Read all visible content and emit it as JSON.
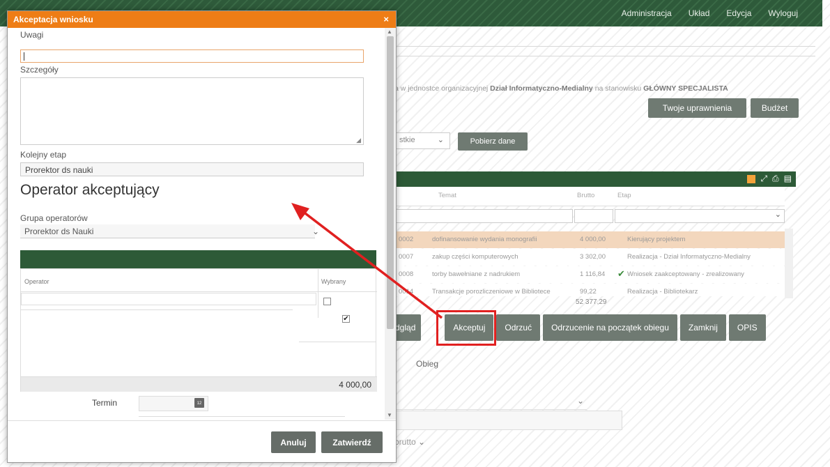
{
  "topnav": [
    "Administracja",
    "Układ",
    "Edycja",
    "Wyloguj"
  ],
  "info": {
    "prefix": "a w jednostce organizacyjnej ",
    "unit": "Dział Informatyczno-Medialny",
    "middle": " na stanowisku ",
    "position": "GŁÓWNY SPECJALISTA"
  },
  "buttons": {
    "permissions": "Twoje uprawnienia",
    "budget": "Budżet",
    "fetch": "Pobierz dane"
  },
  "filter": {
    "value": "stkie"
  },
  "table": {
    "headers": [
      "Temat",
      "Brutto",
      "Etap"
    ],
    "rows": [
      {
        "num": "0002",
        "topic": "dofinansowanie wydania monografii",
        "gross": "4 000,00",
        "stage": "Kierujący projektem"
      },
      {
        "num": "0007",
        "topic": "zakup części komputerowych",
        "gross": "3 302,00",
        "stage": "Realizacja - Dział Informatyczno-Medialny"
      },
      {
        "num": "0008",
        "topic": "torby bawełniane z nadrukiem",
        "gross": "1 116,84",
        "stage": "Wniosek zaakceptowany - zrealizowany"
      },
      {
        "num": "0014",
        "topic": "Transakcje porozliczeniowe w Bibliotece",
        "gross": "99,22",
        "stage": "Realizacja - Bibliotekarz"
      }
    ],
    "sum": "52 377,29"
  },
  "actions": [
    "dgląd",
    "Akceptuj",
    "Odrzuć",
    "Odrzucenie na początek obiegu",
    "Zamknij",
    "OPIS"
  ],
  "tab_obieg": "Obieg",
  "brutto_label": "brutto",
  "modal": {
    "title": "Akceptacja wniosku",
    "close": "×",
    "uwagi_label": "Uwagi",
    "uwagi_value": "",
    "szczegoly_label": "Szczegóły",
    "kolejny_label": "Kolejny etap",
    "kolejny_value": "Prorektor ds nauki",
    "section_title": "Operator akceptujący",
    "grupa_label": "Grupa operatorów",
    "grupa_value": "Prorektor ds Nauki",
    "col_operator": "Operator",
    "col_wybrany": "Wybrany",
    "total": "4 000,00",
    "termin_label": "Termin",
    "btn_cancel": "Anuluj",
    "btn_confirm": "Zatwierdź"
  }
}
